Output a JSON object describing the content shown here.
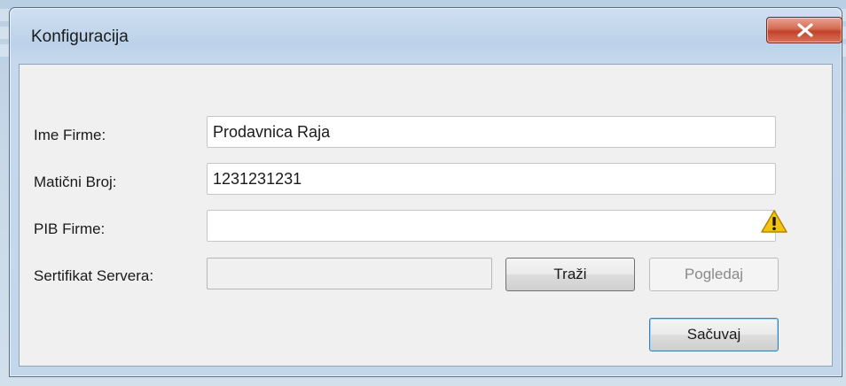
{
  "window": {
    "title": "Konfiguracija"
  },
  "form": {
    "company_name_label": "Ime Firme:",
    "company_name_value": "Prodavnica Raja",
    "reg_number_label": "Matični Broj:",
    "reg_number_value": "1231231231",
    "pib_label": "PIB Firme:",
    "pib_value": "",
    "certificate_label": "Sertifikat Servera:",
    "certificate_value": ""
  },
  "buttons": {
    "browse_label": "Traži",
    "view_label": "Pogledaj",
    "save_label": "Sačuvaj"
  },
  "icons": {
    "close": "close-icon",
    "warning": "warning-icon"
  },
  "colors": {
    "close_button": "#c8452e",
    "warning": "#f2c40f"
  }
}
